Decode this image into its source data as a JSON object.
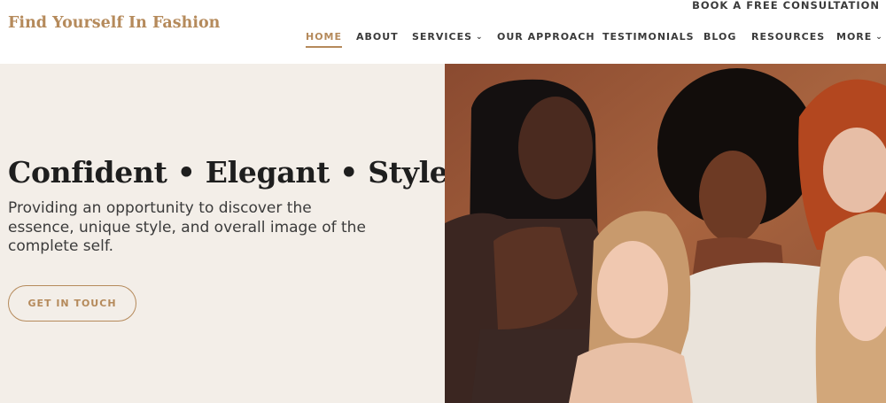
{
  "header": {
    "logo_text": "Find Yourself In Fashion",
    "book_link": "BOOK A FREE CONSULTATION"
  },
  "nav": {
    "items": [
      {
        "label": "HOME",
        "active": true
      },
      {
        "label": "ABOUT"
      },
      {
        "label": "SERVICES",
        "dropdown": true
      },
      {
        "label": "OUR APPROACH"
      },
      {
        "label": "TESTIMONIALS"
      },
      {
        "label": "BLOG"
      },
      {
        "label": "RESOURCES"
      },
      {
        "label": "MORE",
        "dropdown": true
      }
    ]
  },
  "hero": {
    "title": "Confident • Elegant • Style",
    "subtitle": "Providing an opportunity to discover the essence, unique style, and overall image of the complete self.",
    "cta_label": "GET IN TOUCH"
  },
  "colors": {
    "accent": "#b58a5b",
    "hero_background": "#f3eee8",
    "text_dark": "#1e1e1e",
    "photo_background": "#9a5a3c"
  },
  "icons": {
    "dropdown": "chevron-down-icon"
  }
}
